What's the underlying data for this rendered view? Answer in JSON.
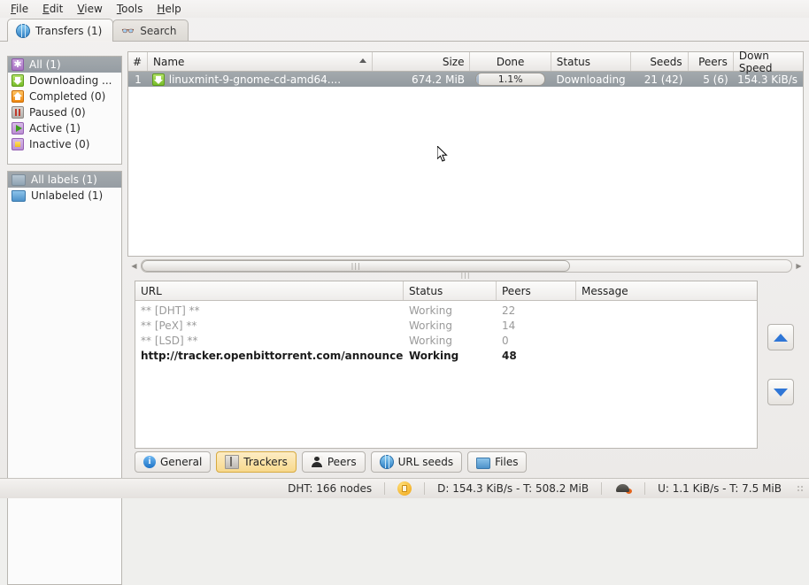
{
  "menubar": {
    "items": [
      {
        "label": "File",
        "mnemonic": "F"
      },
      {
        "label": "Edit",
        "mnemonic": "E"
      },
      {
        "label": "View",
        "mnemonic": "V"
      },
      {
        "label": "Tools",
        "mnemonic": "T"
      },
      {
        "label": "Help",
        "mnemonic": "H"
      }
    ]
  },
  "tabs": [
    {
      "label": "Transfers (1)",
      "icon": "globe-icon",
      "active": true
    },
    {
      "label": "Search",
      "icon": "binoculars-icon",
      "active": false
    }
  ],
  "sidebar": {
    "status_filters": [
      {
        "label": "All (1)",
        "icon": "asterisk-icon",
        "selected": true
      },
      {
        "label": "Downloading ...",
        "icon": "download-arrow-icon",
        "selected": false
      },
      {
        "label": "Completed (0)",
        "icon": "upload-arrow-icon",
        "selected": false
      },
      {
        "label": "Paused (0)",
        "icon": "pause-icon",
        "selected": false
      },
      {
        "label": "Active (1)",
        "icon": "play-icon",
        "selected": false
      },
      {
        "label": "Inactive (0)",
        "icon": "stop-icon",
        "selected": false
      }
    ],
    "label_filters": [
      {
        "label": "All labels (1)",
        "icon": "folder-icon",
        "selected": true
      },
      {
        "label": "Unlabeled (1)",
        "icon": "folder-icon",
        "selected": false
      }
    ]
  },
  "transfers": {
    "columns": [
      "#",
      "Name",
      "Size",
      "Done",
      "Status",
      "Seeds",
      "Peers",
      "Down Speed"
    ],
    "sort_column": "Name",
    "sort_direction": "ascending",
    "rows": [
      {
        "num": "1",
        "name": "linuxmint-9-gnome-cd-amd64....",
        "size": "674.2 MiB",
        "done": "1.1%",
        "done_value": 1.1,
        "status": "Downloading",
        "seeds": "21 (42)",
        "peers": "5 (6)",
        "down_speed": "154.3 KiB/s",
        "selected": true
      }
    ]
  },
  "trackers": {
    "columns": [
      "URL",
      "Status",
      "Peers",
      "Message"
    ],
    "rows": [
      {
        "url": "** [DHT] **",
        "status": "Working",
        "peers": "22",
        "message": "",
        "dim": true
      },
      {
        "url": "** [PeX] **",
        "status": "Working",
        "peers": "14",
        "message": "",
        "dim": true
      },
      {
        "url": "** [LSD] **",
        "status": "Working",
        "peers": "0",
        "message": "",
        "dim": true
      },
      {
        "url": "http://tracker.openbittorrent.com/announce",
        "status": "Working",
        "peers": "48",
        "message": "",
        "dim": false
      }
    ]
  },
  "detail_tabs": [
    {
      "label": "General",
      "icon": "info-icon",
      "active": false
    },
    {
      "label": "Trackers",
      "icon": "tracker-icon",
      "active": true
    },
    {
      "label": "Peers",
      "icon": "person-icon",
      "active": false
    },
    {
      "label": "URL seeds",
      "icon": "globe-link-icon",
      "active": false
    },
    {
      "label": "Files",
      "icon": "folder-icon",
      "active": false
    }
  ],
  "statusbar": {
    "dht": "DHT: 166 nodes",
    "download": "D: 154.3 KiB/s - T: 508.2 MiB",
    "upload": "U: 1.1 KiB/s - T: 7.5 MiB",
    "lock_icon": "encryption-icon",
    "speed_icon": "alt-speed-turtle-icon"
  },
  "colors": {
    "selection": "#9aa1a7",
    "accent_active_tab": "#f8d98c",
    "link_blue": "#2f76d6"
  }
}
